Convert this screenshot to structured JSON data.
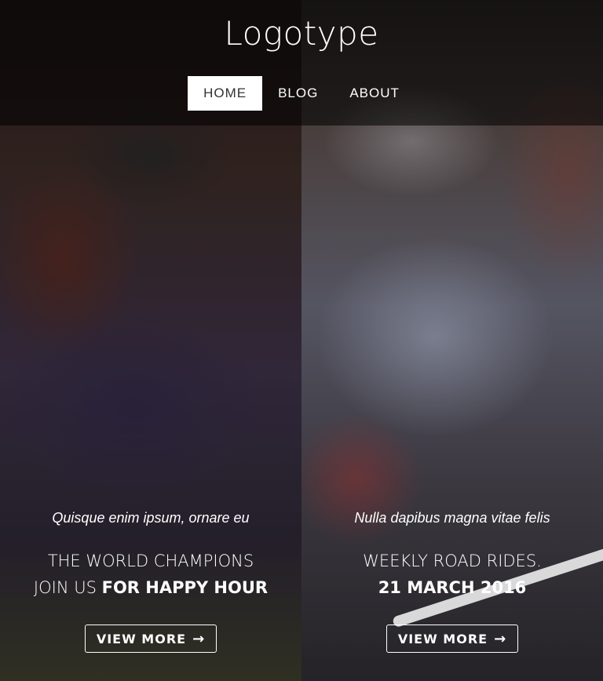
{
  "header": {
    "logo": "Logotype",
    "nav": [
      {
        "label": "HOME",
        "active": true
      },
      {
        "label": "BLOG",
        "active": false
      },
      {
        "label": "ABOUT",
        "active": false
      }
    ]
  },
  "panels": [
    {
      "tagline": "Quisque enim ipsum, ornare eu",
      "heading_line1": "THE WORLD CHAMPIONS",
      "heading_line2_light": "JOIN US ",
      "heading_line2_bold": "FOR HAPPY HOUR",
      "button_label": "VIEW MORE",
      "button_icon": "arrow-right-icon"
    },
    {
      "tagline": "Nulla dapibus magna vitae felis",
      "heading_line1": "WEEKLY ROAD RIDES.",
      "heading_line2_light": "",
      "heading_line2_bold": "21 MARCH 2016",
      "button_label": "VIEW MORE",
      "button_icon": "arrow-right-icon"
    }
  ],
  "colors": {
    "text": "#ffffff",
    "active_nav_bg": "#ffffff",
    "active_nav_text": "#333333",
    "header_overlay": "rgba(0,0,0,0.55)"
  }
}
